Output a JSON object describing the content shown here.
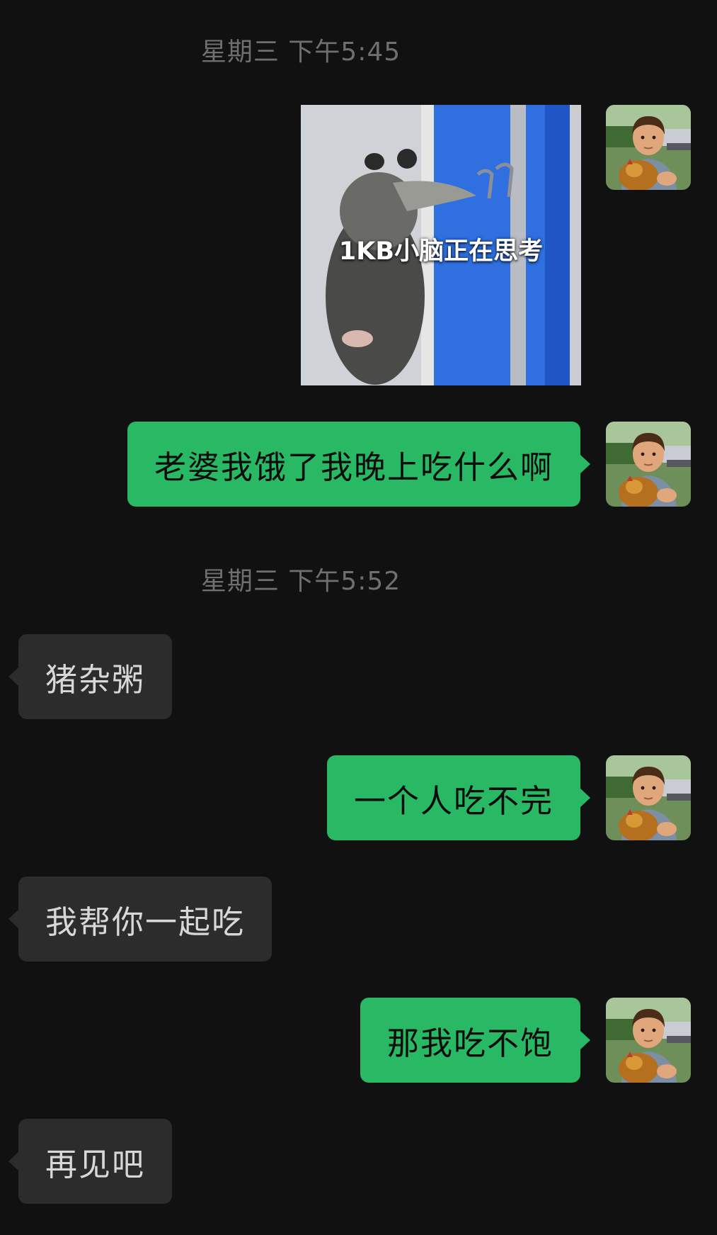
{
  "chat": {
    "timestamps": [
      "星期三 下午5:45",
      "星期三 下午5:52"
    ],
    "sticker": {
      "caption": "1KB小脑正在思考",
      "subject": "opossum-looking-out-window"
    },
    "messages": [
      {
        "sender": "me",
        "text": "老婆我饿了我晚上吃什么啊"
      },
      {
        "sender": "them",
        "text": "猪杂粥"
      },
      {
        "sender": "me",
        "text": "一个人吃不完"
      },
      {
        "sender": "them",
        "text": "我帮你一起吃"
      },
      {
        "sender": "me",
        "text": "那我吃不饱"
      },
      {
        "sender": "them",
        "text": "再见吧"
      }
    ]
  },
  "colors": {
    "background": "#111111",
    "my_bubble": "#29b864",
    "their_bubble": "#2c2c2c",
    "timestamp": "#6f6f6f"
  },
  "icons": {
    "avatar": "boy-with-chicken-avatar"
  }
}
